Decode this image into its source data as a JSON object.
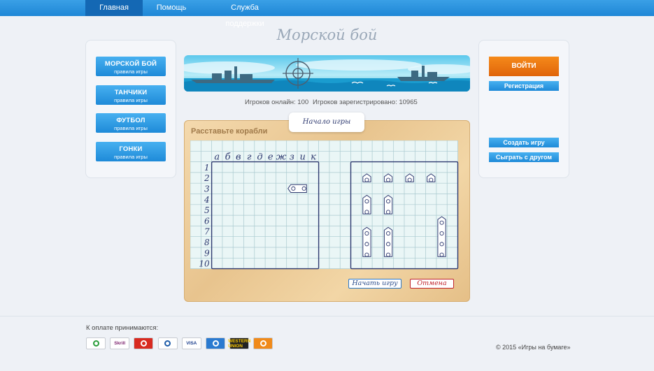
{
  "nav": {
    "items": [
      "Главная",
      "Помощь",
      "Служба поддержки"
    ]
  },
  "site_title": "Морской бой",
  "left_menu": [
    {
      "title": "МОРСКОЙ БОЙ",
      "subtitle": "правила игры"
    },
    {
      "title": "ТАНЧИКИ",
      "subtitle": "правила игры"
    },
    {
      "title": "ФУТБОЛ",
      "subtitle": "правила игры"
    },
    {
      "title": "ГОНКИ",
      "subtitle": "правила игры"
    }
  ],
  "right_panel": {
    "login": "ВОЙТИ",
    "register": "Регистрация",
    "create_game": "Создать игру",
    "play_friend": "Сыграть с другом"
  },
  "stats": {
    "online": "Игроков онлайн: 100",
    "registered": "Игроков зарегистрировано: 10965"
  },
  "game": {
    "tab_label": "Начало игры",
    "board_title": "Расставьте корабли",
    "columns": [
      "а",
      "б",
      "в",
      "г",
      "д",
      "е",
      "ж",
      "з",
      "и",
      "к"
    ],
    "rows": [
      "1",
      "2",
      "3",
      "4",
      "5",
      "6",
      "7",
      "8",
      "9",
      "10"
    ],
    "start_button": "Начать игру",
    "cancel_button": "Отмена"
  },
  "footer": {
    "payment_label": "К оплате принимаются:",
    "payment_methods": [
      {
        "name": "sberbank-icon",
        "label": "",
        "bg": "#ffffff",
        "fg": "#2a9d3a"
      },
      {
        "name": "skrill-icon",
        "label": "Skrill",
        "bg": "#ffffff",
        "fg": "#7a1f6b"
      },
      {
        "name": "opera-icon",
        "label": "",
        "bg": "#d82a20",
        "fg": "#ffffff"
      },
      {
        "name": "webmoney-icon",
        "label": "",
        "bg": "#ffffff",
        "fg": "#1e5ca8"
      },
      {
        "name": "visa-icon",
        "label": "VISA",
        "bg": "#ffffff",
        "fg": "#1a3d8c"
      },
      {
        "name": "webmoney-globe-icon",
        "label": "",
        "bg": "#2a7ad0",
        "fg": "#ffffff"
      },
      {
        "name": "western-union-icon",
        "label": "WESTERN UNION",
        "bg": "#222222",
        "fg": "#f5c400"
      },
      {
        "name": "yandex-money-icon",
        "label": "",
        "bg": "#f08a1a",
        "fg": "#ffffff"
      }
    ],
    "copyright": "© 2015 «Игры на бумаге»"
  },
  "colors": {
    "accent": "#1e86d6",
    "orange": "#e97310",
    "grid_line": "#2e3a70",
    "cancel_red": "#c0222a"
  }
}
